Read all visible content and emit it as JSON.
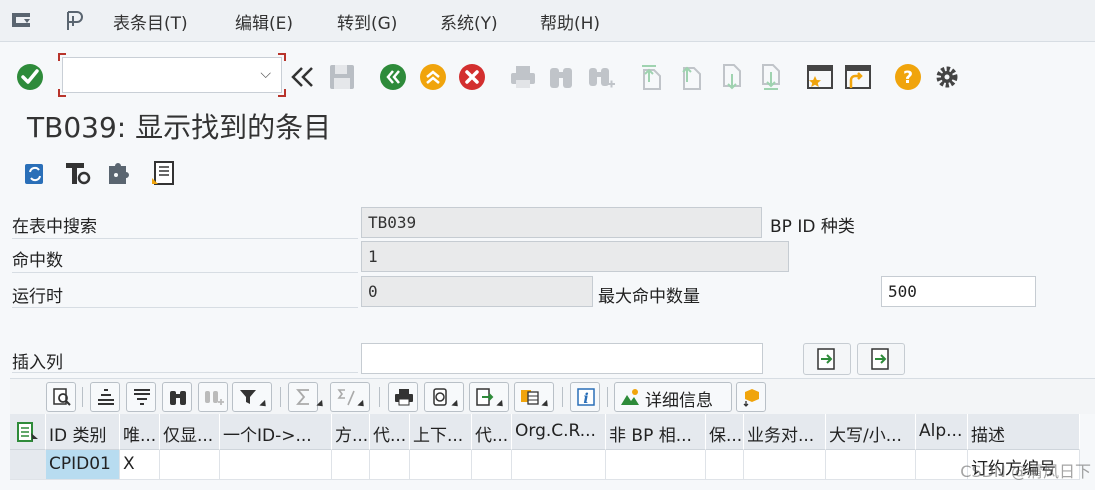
{
  "menu": {
    "items": [
      "表条目(T)",
      "编辑(E)",
      "转到(G)",
      "系统(Y)",
      "帮助(H)"
    ]
  },
  "toolbar": {
    "command_value": "",
    "icons": [
      "enter-icon",
      "back-icon",
      "save-icon",
      "back-green-icon",
      "exit-icon",
      "cancel-icon",
      "print-icon",
      "find-icon",
      "find-next-icon",
      "first-page-icon",
      "prev-page-icon",
      "next-page-icon",
      "last-page-icon",
      "new-session-icon",
      "shortcut-icon",
      "help-icon",
      "settings-icon"
    ]
  },
  "title": "TB039: 显示找到的条目",
  "form": {
    "search_table_label": "在表中搜索",
    "search_table_value": "TB039",
    "search_table_desc": "BP ID 种类",
    "hits_label": "命中数",
    "hits_value": "1",
    "runtime_label": "运行时",
    "runtime_value": "0",
    "max_hits_label": "最大命中数量",
    "max_hits_value": "500",
    "insert_col_label": "插入列",
    "insert_col_value": ""
  },
  "grid_toolbar": {
    "details_label": "详细信息"
  },
  "grid": {
    "columns": [
      "ID 类别",
      "唯...",
      "仅显...",
      "一个ID->...",
      "方...",
      "代...",
      "上下...",
      "代...",
      "Org.C.R...",
      "非 BP 相...",
      "保...",
      "业务对...",
      "大写/小...",
      "Alp...",
      "描述"
    ],
    "rows": [
      [
        "CPID01",
        "X",
        "",
        "",
        "",
        "",
        "",
        "",
        "",
        "",
        "",
        "",
        "",
        "",
        "订约方编号"
      ]
    ]
  },
  "watermark": "CSDN @清风日下",
  "colors": {
    "accent_green": "#2e8b3a",
    "warn_orange": "#f0a40c",
    "red": "#d32f2f",
    "key_cell": "#b8dcf0"
  }
}
